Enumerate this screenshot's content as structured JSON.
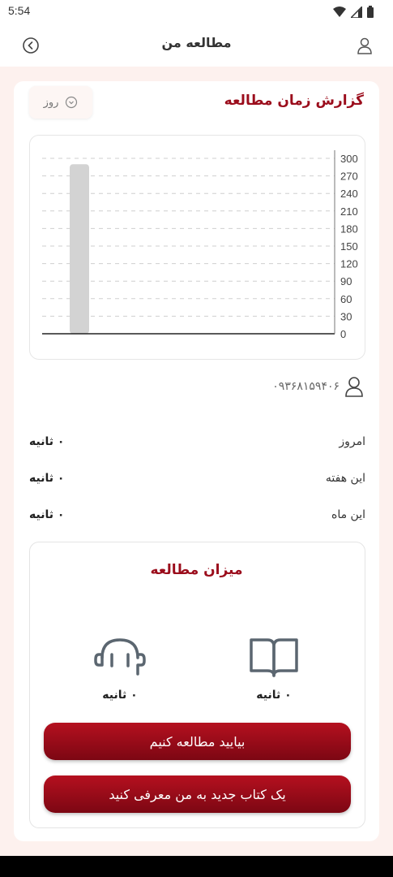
{
  "status_bar": {
    "time": "5:54"
  },
  "app_bar": {
    "title": "مطالعه من"
  },
  "report": {
    "title": "گزارش زمان مطالعه",
    "period": "روز"
  },
  "chart_data": {
    "type": "bar",
    "categories": [
      ""
    ],
    "values": [
      290
    ],
    "ylim": [
      0,
      300
    ],
    "yticks": [
      0,
      30,
      60,
      90,
      120,
      150,
      180,
      210,
      240,
      270,
      300
    ],
    "grid": true,
    "bar_color": "#d3d3d3"
  },
  "user": {
    "phone": "۰۹۳۶۸۱۵۹۴۰۶"
  },
  "stats": [
    {
      "label": "امروز",
      "value": "۰ ثانیه"
    },
    {
      "label": "این هفته",
      "value": "۰ ثانیه"
    },
    {
      "label": "این ماه",
      "value": "۰ ثانیه"
    }
  ],
  "amount": {
    "title": "میزان مطالعه",
    "listening": "۰ ثانیه",
    "reading": "۰ ثانیه"
  },
  "buttons": {
    "read": "بیایید مطالعه کنیم",
    "recommend": "یک کتاب جدید به من معرفی کنید"
  },
  "colors": {
    "accent": "#9b0d1c",
    "background": "#fdf1ee"
  }
}
